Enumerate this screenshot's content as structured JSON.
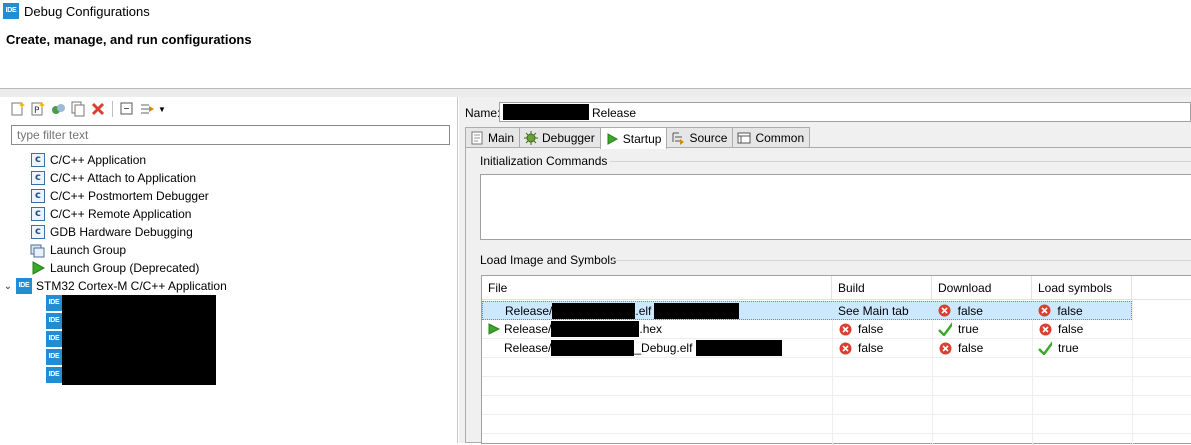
{
  "window": {
    "title": "Debug Configurations",
    "app_icon": "IDE"
  },
  "header": {
    "title": "Create, manage, and run configurations"
  },
  "left": {
    "filter_placeholder": "type filter text",
    "tree": [
      {
        "label": "C/C++ Application",
        "icon": "c-config-icon"
      },
      {
        "label": "C/C++ Attach to Application",
        "icon": "c-config-icon"
      },
      {
        "label": "C/C++ Postmortem Debugger",
        "icon": "c-config-icon"
      },
      {
        "label": "C/C++ Remote Application",
        "icon": "c-config-icon"
      },
      {
        "label": "GDB Hardware Debugging",
        "icon": "c-config-icon"
      },
      {
        "label": "Launch Group",
        "icon": "launch-group-icon"
      },
      {
        "label": "Launch Group (Deprecated)",
        "icon": "run-arrow-icon"
      },
      {
        "label": "STM32 Cortex-M C/C++ Application",
        "icon": "ide-icon",
        "expanded": true
      }
    ],
    "child_icon_label": "IDE"
  },
  "right": {
    "name_label": "Name:",
    "name_suffix": "Release",
    "tabs": [
      {
        "label": "Main",
        "icon": "main-tab-icon"
      },
      {
        "label": "Debugger",
        "icon": "debugger-tab-icon"
      },
      {
        "label": "Startup",
        "icon": "startup-tab-icon",
        "active": true
      },
      {
        "label": "Source",
        "icon": "source-tab-icon"
      },
      {
        "label": "Common",
        "icon": "common-tab-icon"
      }
    ],
    "init_group_title": "Initialization Commands",
    "load_group_title": "Load Image and Symbols",
    "table": {
      "columns": [
        "File",
        "Build",
        "Download",
        "Load symbols"
      ],
      "rows": [
        {
          "file_prefix": "Release/",
          "file_suffix": ".elf",
          "build": "See Main tab",
          "download": "false",
          "load_symbols": "false",
          "selected": true
        },
        {
          "file_prefix": "Release/",
          "file_suffix": ".hex",
          "build": "false",
          "download": "true",
          "load_symbols": "false",
          "run_marker": true
        },
        {
          "file_prefix": "Release/",
          "file_suffix": "_Debug.elf",
          "build": "false",
          "download": "false",
          "load_symbols": "true"
        }
      ]
    }
  },
  "colors": {
    "accent": "#1f8ed6",
    "selection": "#cce8ff",
    "error": "#d9402f",
    "check": "#3aa829"
  }
}
